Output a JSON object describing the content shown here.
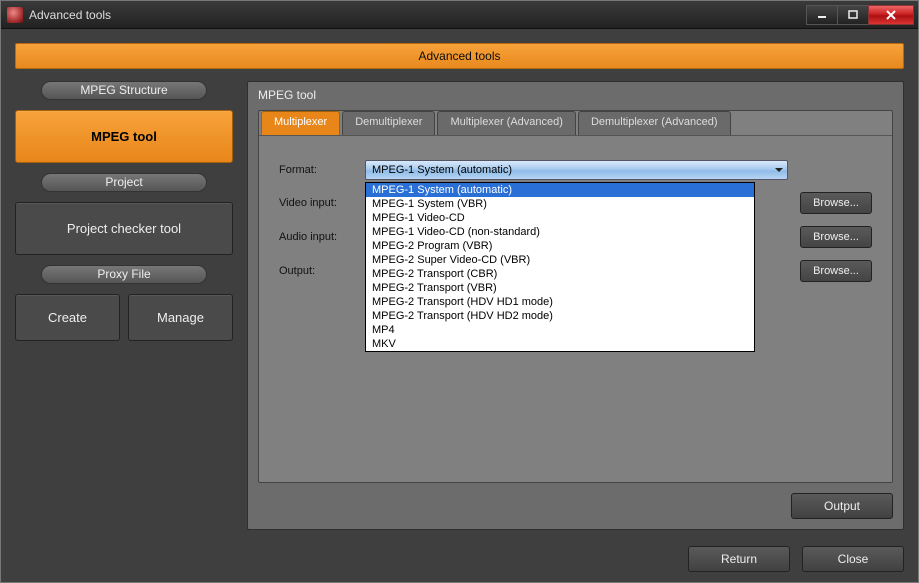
{
  "window": {
    "title": "Advanced tools"
  },
  "banner": "Advanced tools",
  "sidebar": {
    "sections": [
      {
        "label": "MPEG Structure",
        "buttons": [
          {
            "label": "MPEG tool",
            "active": true
          }
        ]
      },
      {
        "label": "Project",
        "buttons": [
          {
            "label": "Project checker tool"
          }
        ]
      },
      {
        "label": "Proxy File",
        "buttons": [
          {
            "label": "Create"
          },
          {
            "label": "Manage"
          }
        ]
      }
    ]
  },
  "panel": {
    "title": "MPEG tool",
    "tabs": [
      "Multiplexer",
      "Demultiplexer",
      "Multiplexer (Advanced)",
      "Demultiplexer (Advanced)"
    ],
    "active_tab": 0,
    "rows": {
      "format_label": "Format:",
      "video_label": "Video input:",
      "audio_label": "Audio input:",
      "output_label": "Output:",
      "browse": "Browse..."
    },
    "format_selected": "MPEG-1 System (automatic)",
    "format_options": [
      "MPEG-1 System (automatic)",
      "MPEG-1 System (VBR)",
      "MPEG-1 Video-CD",
      "MPEG-1 Video-CD (non-standard)",
      "MPEG-2 Program (VBR)",
      "MPEG-2 Super Video-CD (VBR)",
      "MPEG-2 Transport (CBR)",
      "MPEG-2 Transport (VBR)",
      "MPEG-2 Transport (HDV HD1 mode)",
      "MPEG-2 Transport (HDV HD2 mode)",
      "MP4",
      "MKV"
    ],
    "output_button": "Output"
  },
  "bottom": {
    "return": "Return",
    "close": "Close"
  }
}
